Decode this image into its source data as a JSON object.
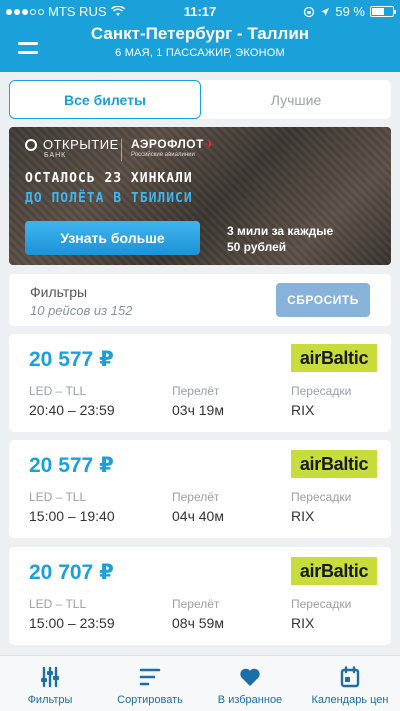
{
  "status_bar": {
    "carrier": "MTS RUS",
    "time": "11:17",
    "battery": "59 %"
  },
  "header": {
    "title": "Санкт-Петербург - Таллин",
    "subtitle": "6 МАЯ, 1 ПАССАЖИР, ЭКОНОМ"
  },
  "tabs": [
    {
      "label": "Все билеты",
      "active": true
    },
    {
      "label": "Лучшие",
      "active": false
    }
  ],
  "banner": {
    "bank_name": "ОТКРЫТИЕ",
    "bank_sub": "БАНК",
    "airline_name": "АЭРОФЛОТ",
    "airline_sub": "Российские авиалинии",
    "line1": "ОСТАЛОСЬ 23 ХИНКАЛИ",
    "line2": "ДО ПОЛЁТА В ТБИЛИСИ",
    "button": "Узнать больше",
    "note_line1": "3 мили за каждые",
    "note_line2": "50 рублей"
  },
  "filters": {
    "title": "Фильтры",
    "count": "10 рейсов из 152",
    "reset": "СБРОСИТЬ"
  },
  "flights": [
    {
      "price": "20 577 ₽",
      "airline": "airBaltic",
      "route": "LED – TLL",
      "times": "20:40 – 23:59",
      "duration_label": "Перелёт",
      "duration": "03ч 19м",
      "transfers_label": "Пересадки",
      "transfers": "RIX"
    },
    {
      "price": "20 577 ₽",
      "airline": "airBaltic",
      "route": "LED – TLL",
      "times": "15:00 – 19:40",
      "duration_label": "Перелёт",
      "duration": "04ч 40м",
      "transfers_label": "Пересадки",
      "transfers": "RIX"
    },
    {
      "price": "20 707 ₽",
      "airline": "airBaltic",
      "route": "LED – TLL",
      "times": "15:00 – 23:59",
      "duration_label": "Перелёт",
      "duration": "08ч 59м",
      "transfers_label": "Пересадки",
      "transfers": "RIX"
    }
  ],
  "bottom_nav": [
    {
      "label": "Фильтры",
      "icon": "sliders-icon"
    },
    {
      "label": "Сортировать",
      "icon": "sort-icon"
    },
    {
      "label": "В избранное",
      "icon": "heart-icon"
    },
    {
      "label": "Календарь цен",
      "icon": "calendar-icon"
    }
  ],
  "colors": {
    "brand": "#1aa1d9",
    "airline_logo": "#c8dc3c",
    "reset_button": "#87b3da",
    "nav_icon": "#1a6fa6"
  }
}
